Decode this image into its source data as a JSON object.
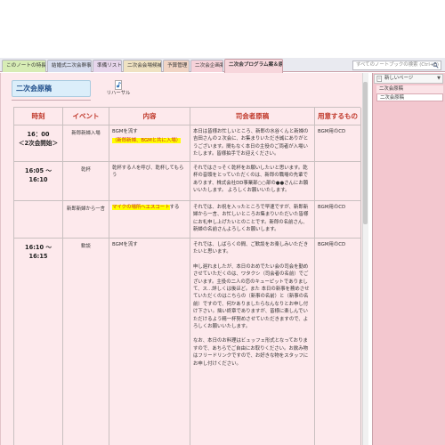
{
  "tabs": [
    {
      "label": "このノートの特長"
    },
    {
      "label": "結婚式二次会幹事"
    },
    {
      "label": "準備リスト"
    },
    {
      "label": "二次会会場候補"
    },
    {
      "label": "予算管理"
    },
    {
      "label": "二次会企画案"
    },
    {
      "label": "二次会プログラム案＆原稿"
    }
  ],
  "search": {
    "placeholder": "すべてのノートブックの検索 (Ctrl+E)"
  },
  "page": {
    "title": "二次会原稿",
    "attachment_label": "リハーサル"
  },
  "table": {
    "headers": [
      "時刻",
      "イベント",
      "内容",
      "司会者原稿",
      "用意するもの"
    ],
    "rows": [
      {
        "time_line1": "16：00",
        "time_line2": "＜2次会開始＞",
        "event": "新郎新婦入場",
        "content_line1": "BGMを流す",
        "content_highlight": "（新郎新婦、BGMと共に入場）",
        "script": "本日は皆様お忙しいところ、新郎の水谷くんと新婦の吉田さんの２次会に、お集まりいただき誠にありがとうございます。間もなく本日の主役のご両者が入場いたします。皆様拍手でお迎えください。",
        "items": "BGM用のCD"
      },
      {
        "time_line1": "16:05 ～ 16:10",
        "event": "乾杯",
        "content": "乾杯する人を呼び、乾杯してもらう",
        "script": "それではさっそく乾杯をお願いしたいと思います。乾杯の音頭をとっていただくのは、新郎の職場の先輩であります、株式会社DD事業部○○部の●●さんにお願いいたします。 よろしくお願いいたします。",
        "items": ""
      },
      {
        "event": "新郎新婦から一言",
        "content_highlight": "マイクの場所へエスコート",
        "content_suffix": "する",
        "script": "それでは、お祝を入ったところで早速ですが、新郎新婦から一言、お忙しいところお集まりいただいた皆様にお礼申し上げたいとのことです。新郎の名前さん、新婦の名前さんよろしくお願いします。",
        "items": "BGM用のCD"
      },
      {
        "time_line1": "16:10 ～ 16:15",
        "event": "歓談",
        "content": "BGMを流す",
        "script_paragraphs": [
          "それでは、しばらくの間、ご歓談をお楽しみいただきたいと思います。",
          "申し遅れましたが、本日のおめでたい会の司会を勤めさせていただくのは、ワタクシ（司会者の名前）でございます。主役の二人の恋のキューピットでありまして、ス…詳しくは後ほど。また 本日の新事を務めさせていただくのはこちらの（新事の名前）と（新事の名前）ですので、何かありましたらなんなりとお申し付け下さい。拙い終章でありますが、皆様に楽しんでいただけるよう精一杯努めさせていただきますので、よろしくお願いいたします。",
          "なお、本日のお料理はビュッフェ形式となっておりますので、あちらでご自由にお取りください。お飲み物はフリードリンクですので、お好きな物をスタッフにお申し付けください。"
        ],
        "items": "BGM用のCD"
      }
    ]
  },
  "right_panel": {
    "new_page_label": "新しいページ",
    "pages": [
      "二次会原稿",
      "二次会原稿"
    ]
  },
  "colors": {
    "page_background": "#fde9ec",
    "header_text": "#c0392b",
    "highlight": "#ffff00",
    "panel_background": "#f3c7cf"
  }
}
